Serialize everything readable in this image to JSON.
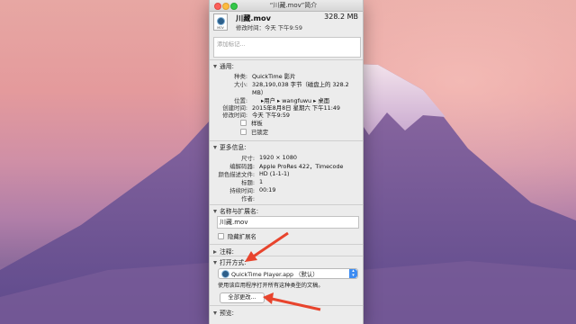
{
  "window": {
    "title": "“川藏.mov”简介",
    "file_icon_ext": "MOV"
  },
  "file": {
    "name": "川藏.mov",
    "size": "328.2 MB",
    "modified": "修改时间：今天 下午9:59"
  },
  "tags": {
    "placeholder": "添加标记..."
  },
  "general": {
    "header": "通用:",
    "kind_label": "种类:",
    "kind_value": "QuickTime 影片",
    "size_label": "大小:",
    "size_value_1": "328,190,038 字节（磁盘上的 328.2",
    "size_value_2": "MB）",
    "where_label": "位置:",
    "where_value": "▸用户 ▸ wangfuwu ▸ 桌面",
    "created_label": "创建时间:",
    "created_value": "2015年8月8日 星期六 下午11:49",
    "modified_label": "修改时间:",
    "modified_value": "今天 下午9:59",
    "stationery_label": "样板",
    "locked_label": "已锁定"
  },
  "more_info": {
    "header": "更多信息:",
    "dimensions_label": "尺寸:",
    "dimensions_value": "1920 × 1080",
    "codecs_label": "编解码器:",
    "codecs_value": "Apple ProRes 422，Timecode",
    "color_label": "颜色描述文件:",
    "color_value": "HD (1-1-1)",
    "title_label": "标题:",
    "title_value": "1",
    "duration_label": "持续时间:",
    "duration_value": "00:19",
    "author_label": "作者:",
    "author_value": ""
  },
  "name_ext": {
    "header": "名称与扩展名:",
    "name_value": "川藏.mov",
    "hide_ext_label": "隐藏扩展名"
  },
  "comments": {
    "header": "注释:"
  },
  "open_with": {
    "header": "打开方式:",
    "app_value": "QuickTime Player.app （默认）",
    "hint": "使用该应用程序打开所有这种类型的文稿。",
    "change_all_label": "全部更改..."
  },
  "preview": {
    "header": "预览:"
  },
  "colors": {
    "arrow": "#e8442d",
    "selector_accent": "#3d8cf2"
  }
}
